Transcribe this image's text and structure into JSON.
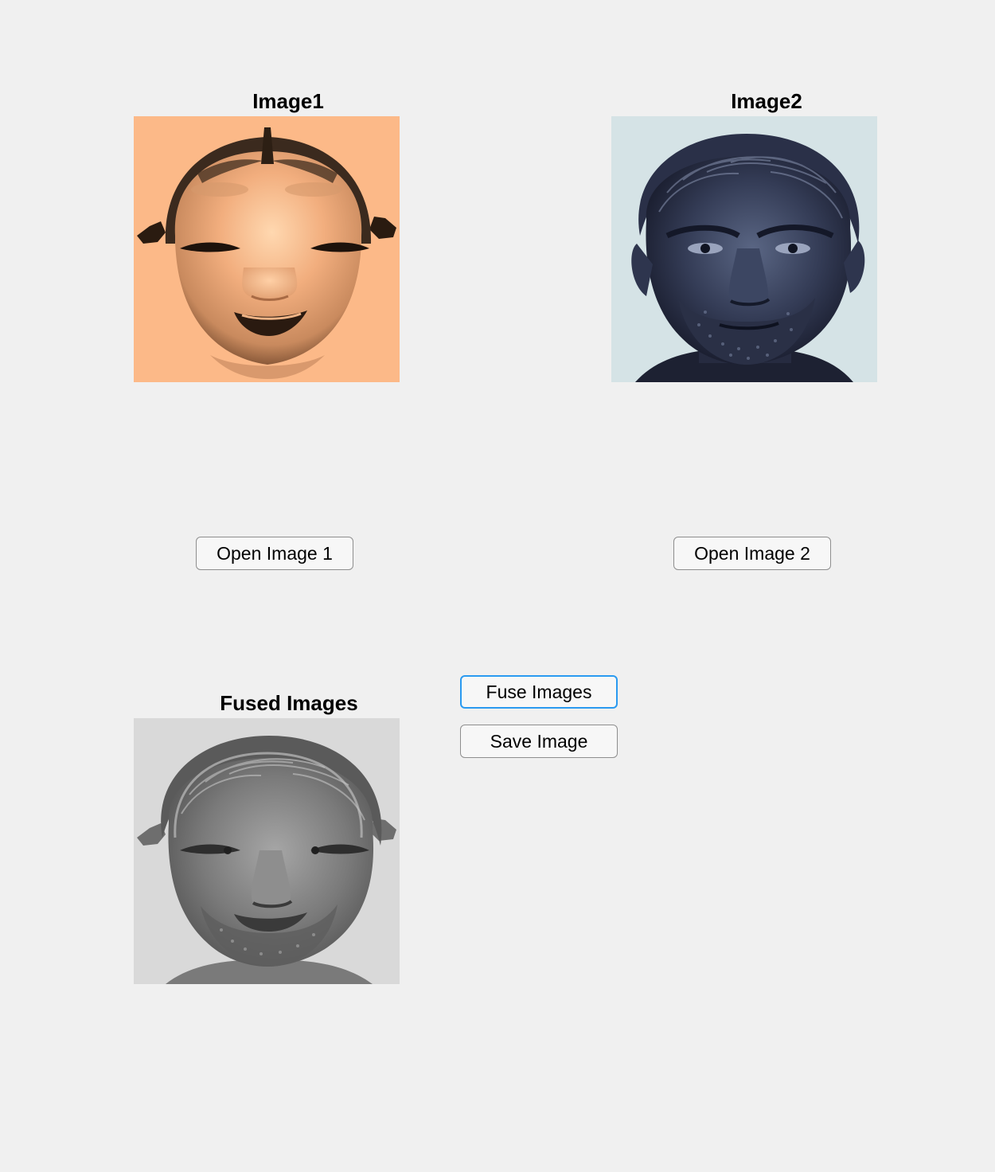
{
  "panels": {
    "image1": {
      "title": "Image1"
    },
    "image2": {
      "title": "Image2"
    },
    "fused": {
      "title": "Fused Images"
    }
  },
  "buttons": {
    "open_image1": "Open Image 1",
    "open_image2": "Open Image 2",
    "fuse_images": "Fuse Images",
    "save_image": "Save Image"
  },
  "colors": {
    "background": "#f0f0f0",
    "focus_ring": "#2a9af0",
    "mask_tone": "#f9b785",
    "bust_tone": "#343c52",
    "fused_tone": "#8c8c8c"
  }
}
